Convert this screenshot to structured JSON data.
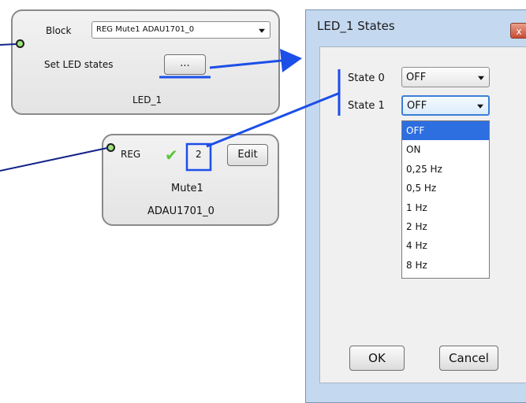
{
  "led_block": {
    "block_label": "Block",
    "block_value": "REG Mute1 ADAU1701_0",
    "set_states_label": "Set LED states",
    "set_states_button": "...",
    "name": "LED_1"
  },
  "reg_block": {
    "type": "REG",
    "check": "✔",
    "number": "2",
    "edit_button": "Edit",
    "name": "Mute1",
    "device": "ADAU1701_0"
  },
  "dialog": {
    "title": "LED_1 States",
    "close": "x",
    "state0_label": "State 0",
    "state0_value": "OFF",
    "state1_label": "State 1",
    "state1_value": "OFF",
    "options": [
      "OFF",
      "ON",
      "0,25 Hz",
      "0,5 Hz",
      "1 Hz",
      "2 Hz",
      "4 Hz",
      "8 Hz"
    ],
    "selected_option": "OFF",
    "ok": "OK",
    "cancel": "Cancel"
  },
  "colors": {
    "annotation_blue": "#1c4ee8",
    "wire_navy": "#14238a",
    "port_green": "#9be37a",
    "check_green": "#5cc43a",
    "list_selection": "#2d6ee0"
  },
  "icons": [
    "port-dot-icon",
    "checkmark-icon",
    "chevron-down-icon",
    "close-icon"
  ]
}
